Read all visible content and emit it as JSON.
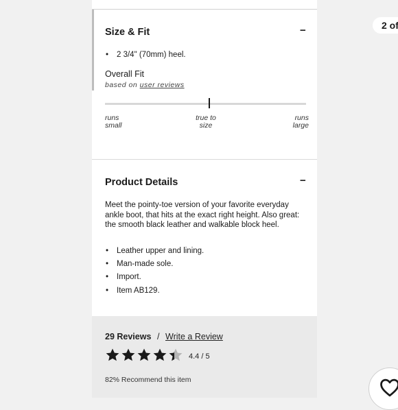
{
  "size_fit": {
    "title": "Size & Fit",
    "toggle": "−",
    "bullets": [
      "2 3/4\" (70mm) heel."
    ],
    "overall_fit": "Overall Fit",
    "based_on": "based on",
    "user_reviews": "user reviews",
    "fit_value": 0.52,
    "scale": {
      "left": [
        "runs",
        "small"
      ],
      "middle": [
        "true to",
        "size"
      ],
      "right": [
        "runs",
        "large"
      ]
    }
  },
  "product_details": {
    "title": "Product Details",
    "toggle": "−",
    "description": "Meet the pointy-toe version of your favorite everyday ankle boot, that hits at the exact right height. Also great: the smooth black leather and walkable block heel.",
    "bullets": [
      "Leather upper and lining.",
      "Man-made sole.",
      "Import.",
      "Item AB129."
    ]
  },
  "reviews": {
    "count": "29 Reviews",
    "separator": "/",
    "write_review": "Write a Review",
    "rating": 4.4,
    "rating_text": "4.4",
    "rating_max": "/ 5",
    "recommend": "82% Recommend this item"
  },
  "carousel": {
    "page_indicator": "2 of"
  },
  "icons": {
    "star": "star-icon",
    "favorite": "heart-icon"
  },
  "colors": {
    "star_filled": "#1a1a1a",
    "star_empty": "#b5b5b5"
  }
}
